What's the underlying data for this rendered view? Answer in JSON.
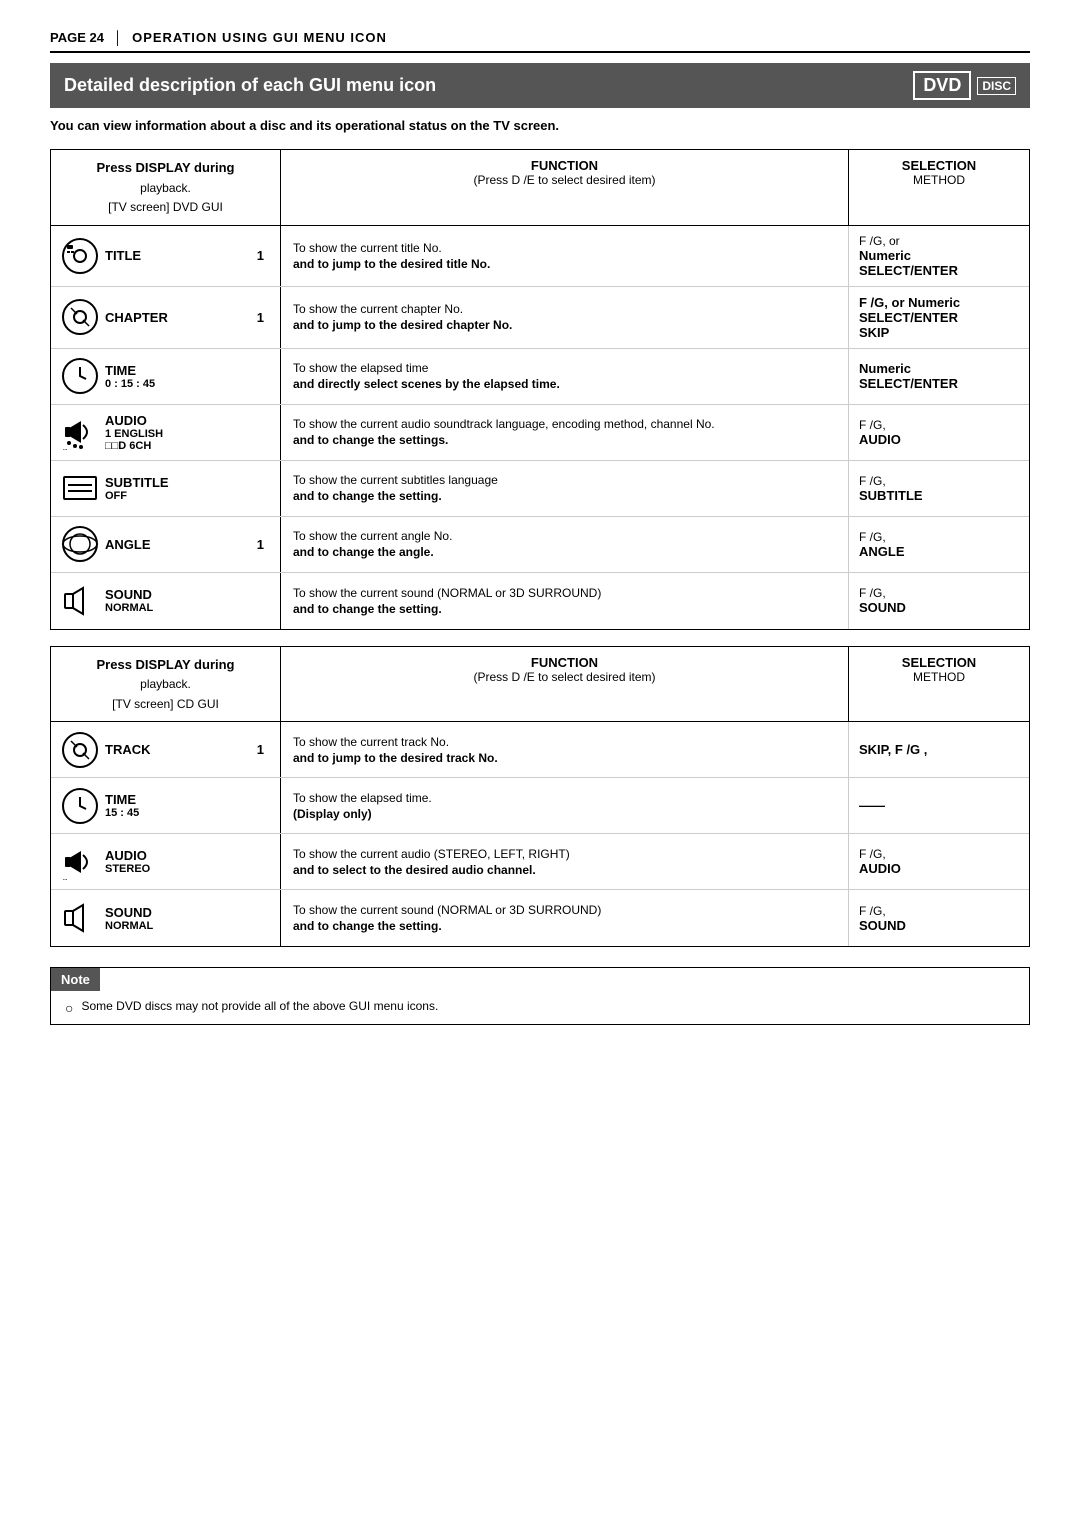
{
  "page": {
    "number": "PAGE 24",
    "title": "OPERATION USING GUI MENU ICON",
    "section_title": "Detailed description of each GUI menu icon",
    "dvd_logo": "DVD",
    "intro": "You can view information about a disc and its operational status on the TV screen."
  },
  "dvd_table": {
    "press_display": {
      "line1": "Press DISPLAY during",
      "line2": "playback.",
      "line3": "[TV screen] DVD GUI"
    },
    "col_function": "FUNCTION",
    "col_function_sub": "(Press D /E  to select desired item)",
    "col_selection": "SELECTION",
    "col_selection_sub": "METHOD",
    "rows": [
      {
        "icon_name": "title-icon",
        "label": "TITLE",
        "number": "1",
        "func_top": "To show the current title No.",
        "func_bold": "and to jump to the desired title No.",
        "sel_line1": "F /G, or",
        "sel_line2": "Numeric",
        "sel_line3": "SELECT/ENTER"
      },
      {
        "icon_name": "chapter-icon",
        "label": "CHAPTER",
        "number": "1",
        "func_top": "To show the current chapter No.",
        "func_bold": "and to jump to the desired chapter No.",
        "sel_line1": "F /G, or Numeric",
        "sel_line2": "SELECT/ENTER",
        "sel_line3": "SKIP"
      },
      {
        "icon_name": "time-icon",
        "label": "TIME",
        "number": "0 : 15 : 45",
        "func_top": "To show the elapsed time",
        "func_bold": "and directly select scenes by the elapsed time.",
        "sel_line1": "Numeric",
        "sel_line2": "SELECT/ENTER",
        "sel_line3": ""
      },
      {
        "icon_name": "audio-icon",
        "label": "AUDIO",
        "detail1": "1 ENGLISH",
        "detail2": "□□D 6CH",
        "func_top": "To show the current audio soundtrack language, encoding method, channel No.",
        "func_bold": "and to change the settings.",
        "sel_line1": "F /G,",
        "sel_line2": "AUDIO",
        "sel_line3": ""
      },
      {
        "icon_name": "subtitle-icon",
        "label": "SUBTITLE",
        "number": "OFF",
        "func_top": "To show the current subtitles language",
        "func_bold": "and to change the setting.",
        "sel_line1": "F /G,",
        "sel_line2": "SUBTITLE",
        "sel_line3": ""
      },
      {
        "icon_name": "angle-icon",
        "label": "ANGLE",
        "number": "1",
        "func_top": "To show the current angle No.",
        "func_bold": "and to change the angle.",
        "sel_line1": "F /G,",
        "sel_line2": "ANGLE",
        "sel_line3": ""
      },
      {
        "icon_name": "sound-icon",
        "label": "SOUND",
        "number": "NORMAL",
        "func_top": "To show the current sound  (NORMAL or 3D SURROUND)",
        "func_bold": "and to change the setting.",
        "sel_line1": "F /G,",
        "sel_line2": "SOUND",
        "sel_line3": ""
      }
    ]
  },
  "cd_table": {
    "press_display": {
      "line1": "Press DISPLAY during",
      "line2": "playback.",
      "line3": "[TV screen] CD GUI"
    },
    "col_function": "FUNCTION",
    "col_function_sub": "(Press D /E  to select desired item)",
    "col_selection": "SELECTION",
    "col_selection_sub": "METHOD",
    "rows": [
      {
        "icon_name": "track-icon",
        "label": "TRACK",
        "number": "1",
        "func_top": "To show the current track No.",
        "func_bold": "and to jump to the desired track No.",
        "sel_line1": "SKIP,  F /G ,",
        "sel_line2": "",
        "sel_line3": ""
      },
      {
        "icon_name": "time-icon",
        "label": "TIME",
        "number": "15 : 45",
        "func_top": "To show the elapsed time.",
        "func_bold": "(Display only)",
        "func_bold_italic": true,
        "sel_line1": "——",
        "sel_line2": "",
        "sel_line3": ""
      },
      {
        "icon_name": "audio-icon",
        "label": "AUDIO",
        "detail1": "STEREO",
        "detail2": "",
        "func_top": "To show the current audio (STEREO, LEFT, RIGHT)",
        "func_bold": "and to select to the desired audio channel.",
        "sel_line1": "F /G,",
        "sel_line2": "AUDIO",
        "sel_line3": ""
      },
      {
        "icon_name": "sound-icon",
        "label": "SOUND",
        "number": "NORMAL",
        "func_top": "To show the current sound (NORMAL or 3D SURROUND)",
        "func_bold": "and to change the setting.",
        "sel_line1": "F /G,",
        "sel_line2": "SOUND",
        "sel_line3": ""
      }
    ]
  },
  "note": {
    "header": "Note",
    "items": [
      "Some DVD discs may not provide all of the above GUI menu icons."
    ]
  }
}
